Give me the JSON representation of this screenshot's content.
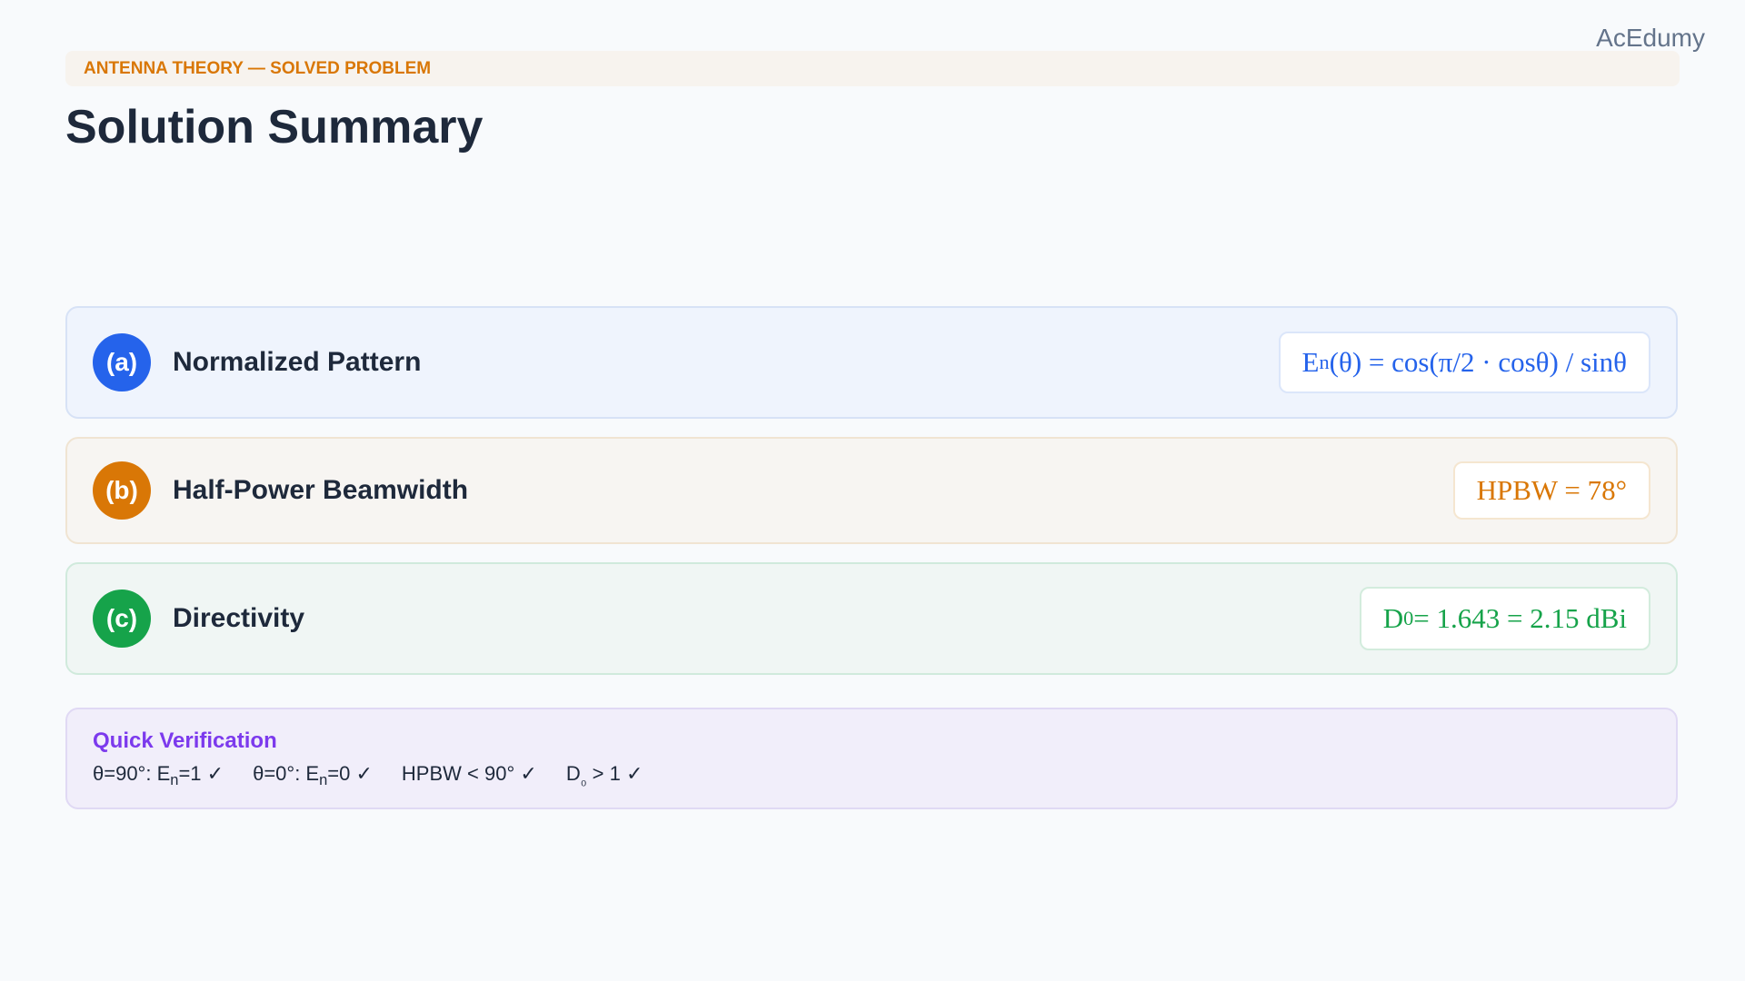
{
  "brand": "AcEdumy",
  "header": {
    "eyebrow": "ANTENNA THEORY — SOLVED PROBLEM",
    "title": "Solution Summary"
  },
  "cards": [
    {
      "badge": "(a)",
      "label": "Normalized Pattern",
      "formula": {
        "main": "E",
        "sub": "n",
        "rest": "(θ) = cos(π/2 · cosθ) / sinθ"
      },
      "color": "#2563eb"
    },
    {
      "badge": "(b)",
      "label": "Half-Power Beamwidth",
      "formula": {
        "main": "HPBW = 78°"
      },
      "color": "#d97706"
    },
    {
      "badge": "(c)",
      "label": "Directivity",
      "formula": {
        "main": "D",
        "sub": "0",
        "rest": " = 1.643 = 2.15 dBi"
      },
      "color": "#16a34a"
    }
  ],
  "verification": {
    "title": "Quick Verification",
    "checks": [
      {
        "pre": "θ=90°: E",
        "sub": "n",
        "post": "=1 ✓"
      },
      {
        "pre": "θ=0°: E",
        "sub": "n",
        "post": "=0 ✓"
      },
      {
        "pre": "HPBW < 90° ✓"
      },
      {
        "pre": "D",
        "sub": "₀",
        "post": " > 1 ✓"
      }
    ]
  }
}
